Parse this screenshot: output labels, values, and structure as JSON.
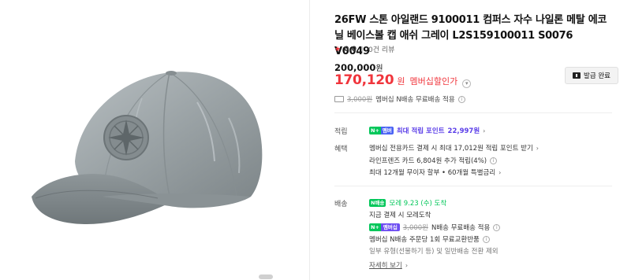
{
  "product": {
    "title": "26FW 스톤 아일랜드 9100011 컴퍼스 자수 나일론 메탈 에코닐 베이스볼 캡 애쉬 그레이 L2S159100011 S0076 V0049",
    "rating_star": "★",
    "rating_score": "0.0",
    "review_count": "0건 리뷰",
    "original_price": "200,000",
    "original_price_unit": "원",
    "sale_price": "170,120",
    "sale_price_unit": "원",
    "sale_label": "멤버십할인가",
    "coupon_button": "발급 완료",
    "shipping_strike": "3,000원",
    "shipping_text": "멤버십 N배송 무료배송 적용"
  },
  "points": {
    "label": "적립",
    "badge": "N+",
    "badge_sub": "멤버",
    "text": "최대 적립 포인트",
    "amount": "22,997원"
  },
  "benefits": {
    "label": "혜택",
    "lines": [
      "멤버십 전용카드 결제 시 최대 17,012원 적립 포인트 받기",
      "라인프렌즈 카드 6,804원 추가 적립(4%)",
      "최대 12개월 무이자 할부 • 60개월 특별금리"
    ]
  },
  "delivery": {
    "label": "배송",
    "badge": "N배송",
    "arrival": "모레 9.23 (수) 도착",
    "arrival_sub": "지금 결제 시 모레도착",
    "member_badge": "N+",
    "member_badge_sub": "멤버십",
    "member_strike": "3,000원",
    "member_text": "N배송 무료배송 적용",
    "return_text": "멤버십 N배송 주문당 1회 무료교환반품",
    "note": "일부 유형(선물하기 등) 및 일반배송 전환 제외",
    "more_link": "자세히 보기"
  },
  "colors": {
    "accent_red": "#f0353c",
    "naver_green": "#03c75a",
    "member_purple": "#5a3de8",
    "cap_gray": "#9aa2a5"
  }
}
